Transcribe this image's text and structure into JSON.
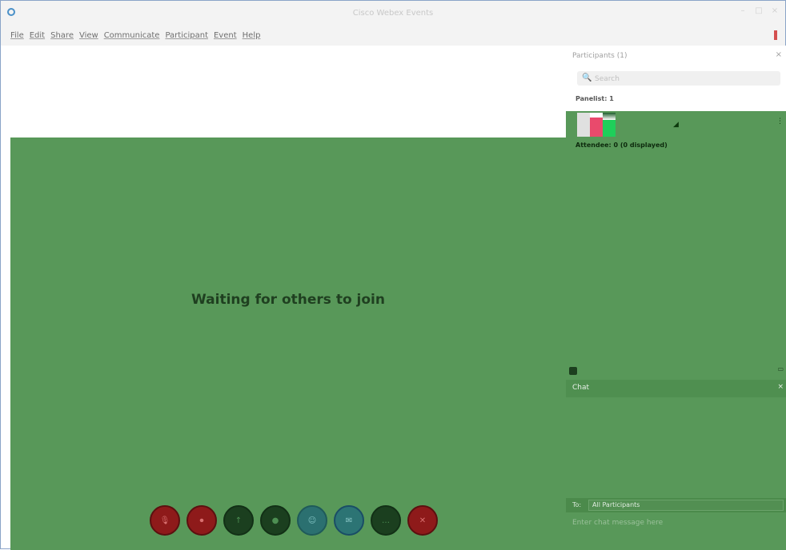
{
  "window": {
    "title": "Cisco Webex Events",
    "controls": [
      "–",
      "□",
      "×"
    ]
  },
  "menu": [
    "File",
    "Edit",
    "Share",
    "View",
    "Communicate",
    "Participant",
    "Event",
    "Help"
  ],
  "stage": {
    "waiting_text": "Waiting for others to join",
    "controls": [
      {
        "name": "mute",
        "color": "#8e1a1a",
        "glyph": "🎙"
      },
      {
        "name": "video",
        "color": "#8e1a1a",
        "glyph": "⏺"
      },
      {
        "name": "share",
        "color": "#1b3f1f",
        "glyph": "↑"
      },
      {
        "name": "record",
        "color": "#1b3f1f",
        "glyph": "●"
      },
      {
        "name": "participants",
        "color": "#2b7070",
        "glyph": "☺"
      },
      {
        "name": "chat",
        "color": "#2c7474",
        "glyph": "✉"
      },
      {
        "name": "more",
        "color": "#1b3f1f",
        "glyph": "…"
      },
      {
        "name": "leave",
        "color": "#8e1a1a",
        "glyph": "✕"
      }
    ]
  },
  "participants": {
    "header": "Participants (1)",
    "close": "×",
    "search_placeholder": "Search",
    "panelist_group": "Panelist: 1",
    "attendee_group": "Attendee: 0 (0 displayed)"
  },
  "chat": {
    "header": "Chat",
    "to_label": "To:",
    "to_value": "All Participants",
    "input_placeholder": "Enter chat message here"
  }
}
